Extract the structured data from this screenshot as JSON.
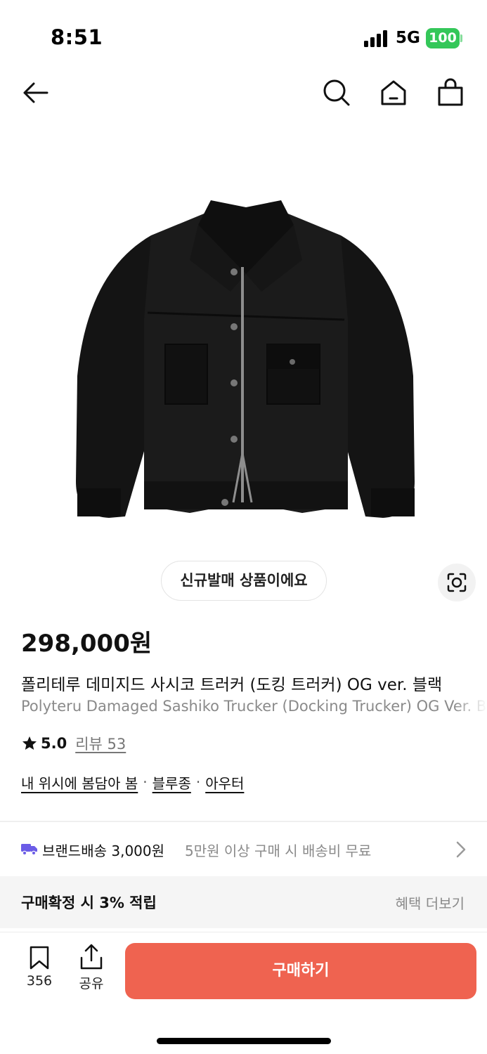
{
  "status_bar": {
    "time": "8:51",
    "network": "5G",
    "battery": "100",
    "battery_color": "#34c759"
  },
  "nav": {
    "back_icon": "arrow-left-icon",
    "search_icon": "search-icon",
    "home_icon": "home-icon",
    "cart_icon": "shopping-bag-icon"
  },
  "product": {
    "image": "black-denim-trucker-jacket",
    "new_badge": "신규발매 상품이에요",
    "lens_icon": "visual-search-icon",
    "price": "298,000원",
    "title_ko": "폴리테루 데미지드 사시코 트러커 (도킹 트러커) OG ver. 블랙",
    "title_en": "Polyteru Damaged Sashiko Trucker (Docking Trucker) OG Ver. Black",
    "rating": "5.0",
    "review_label": "리뷰 53"
  },
  "breadcrumbs": [
    "내 위시에 봄담아 봄",
    "블루종",
    "아우터"
  ],
  "breadcrumb_separator": "·",
  "shipping": {
    "icon": "truck-icon",
    "icon_color": "#6b5ce7",
    "brand": "브랜드배송 3,000원",
    "condition": "5만원 이상 구매 시 배송비 무료"
  },
  "benefit": {
    "text": "구매확정 시 3% 적립",
    "more": "혜택 더보기"
  },
  "bottom_bar": {
    "save_count": "356",
    "share_label": "공유",
    "buy_label": "구매하기",
    "buy_color": "#ef6350"
  }
}
